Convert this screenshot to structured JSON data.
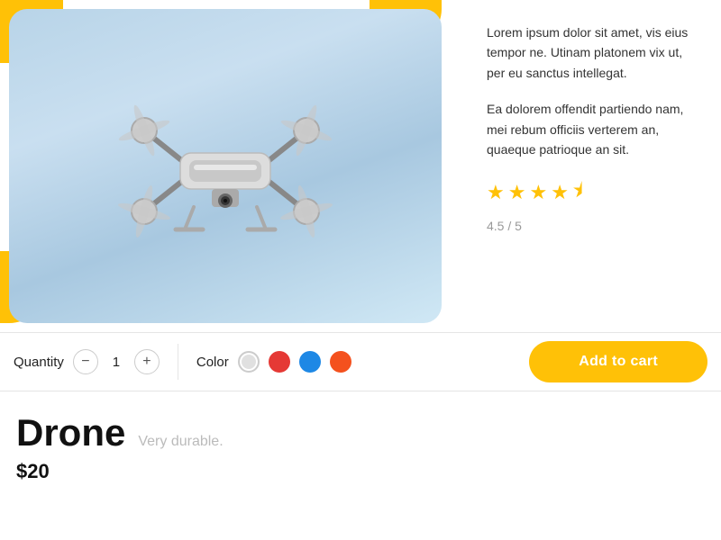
{
  "product": {
    "name": "Drone",
    "tagline": "Very durable.",
    "price": "$20",
    "description1": "Lorem ipsum dolor sit amet, vis eius tempor ne. Utinam platonem vix ut, per eu sanctus intellegat.",
    "description2": "Ea dolorem offendit partiendo nam, mei rebum officiis verterem an, quaeque patrioque an sit.",
    "rating": "4.5 / 5",
    "quantity": "1"
  },
  "controls": {
    "quantity_label": "Quantity",
    "color_label": "Color",
    "add_to_cart": "Add to cart",
    "minus_icon": "−",
    "plus_icon": "+"
  },
  "colors": [
    {
      "name": "white",
      "hex": "#e0e0e0"
    },
    {
      "name": "red",
      "hex": "#e53935"
    },
    {
      "name": "blue",
      "hex": "#1E88E5"
    },
    {
      "name": "orange",
      "hex": "#F4511E"
    }
  ]
}
